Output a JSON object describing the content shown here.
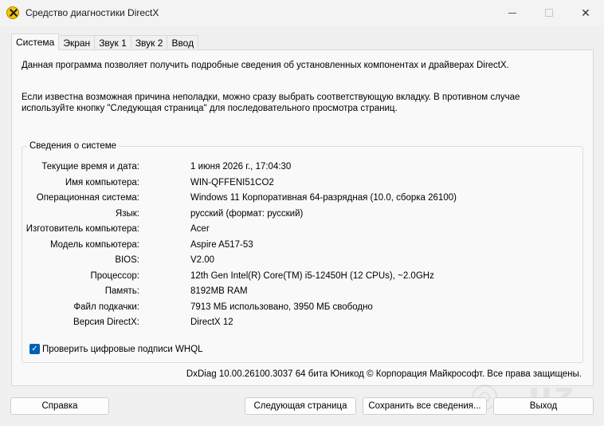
{
  "window": {
    "title": "Средство диагностики DirectX",
    "icons": [
      "directx-icon",
      "minimize-icon",
      "maximize-icon",
      "close-icon"
    ]
  },
  "tabs": [
    {
      "label": "Система",
      "active": true
    },
    {
      "label": "Экран",
      "active": false
    },
    {
      "label": "Звук 1",
      "active": false
    },
    {
      "label": "Звук 2",
      "active": false
    },
    {
      "label": "Ввод",
      "active": false
    }
  ],
  "intro": {
    "line1": "Данная программа позволяет получить подробные сведения об установленных компонентах и драйверах DirectX.",
    "line2": "Если известна возможная причина неполадки, можно сразу выбрать соответствующую вкладку. В противном случае используйте кнопку \"Следующая страница\" для последовательного просмотра страниц."
  },
  "system_info": {
    "title": "Сведения о системе",
    "rows": [
      {
        "label": "Текущие время и дата:",
        "value": "1 июня 2026 г., 17:04:30"
      },
      {
        "label": "Имя компьютера:",
        "value": "WIN-QFFENI51CO2"
      },
      {
        "label": "Операционная система:",
        "value": "Windows 11 Корпоративная 64-разрядная (10.0, сборка 26100)"
      },
      {
        "label": "Язык:",
        "value": "русский (формат: русский)"
      },
      {
        "label": "Изготовитель компьютера:",
        "value": "Acer"
      },
      {
        "label": "Модель компьютера:",
        "value": "Aspire A517-53"
      },
      {
        "label": "BIOS:",
        "value": "V2.00"
      },
      {
        "label": "Процессор:",
        "value": "12th Gen Intel(R) Core(TM) i5-12450H (12 CPUs), ~2.0GHz"
      },
      {
        "label": "Память:",
        "value": "8192MB RAM"
      },
      {
        "label": "Файл подкачки:",
        "value": "7913 МБ использовано, 3950 МБ свободно"
      },
      {
        "label": "Версия DirectX:",
        "value": "DirectX 12"
      }
    ]
  },
  "whql": {
    "label": "Проверить цифровые подписи WHQL",
    "checked": true
  },
  "footer_note": "DxDiag 10.00.26100.3037 64 бита Юникод © Корпорация Майкрософт. Все права защищены.",
  "buttons": {
    "help": "Справка",
    "next": "Следующая страница",
    "save": "Сохранить все сведения...",
    "exit": "Выход"
  },
  "colors": {
    "accent": "#005fb8",
    "background": "#f0f0f0",
    "panel": "#f9f9f9"
  }
}
